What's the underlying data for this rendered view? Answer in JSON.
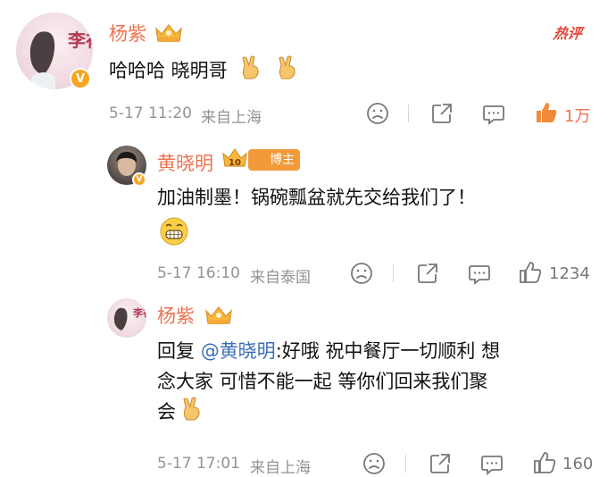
{
  "comments": [
    {
      "username": "杨紫",
      "text": "哈哈哈 晓明哥",
      "time": "5-17 11:20",
      "location": "来自上海",
      "likes": "1万",
      "hot_label": "热评",
      "avatar_text": "李祐"
    },
    {
      "username": "黄晓明",
      "level": "10",
      "blogger_label": "博主",
      "text": "加油制墨！锅碗瓢盆就先交给我们了！",
      "time": "5-17 16:10",
      "location": "来自泰国",
      "likes": "1234"
    },
    {
      "username": "杨紫",
      "reply_prefix": "回复 ",
      "mention": "@黄晓明",
      "text_line1": ":好哦 祝中餐厅一切顺利 想",
      "text_line2": "念大家 可惜不能一起 等你们回来我们聚",
      "text_line3": "会",
      "time": "5-17 17:01",
      "location": "来自上海",
      "likes": "160"
    }
  ],
  "icons": {
    "dislike": "sad-face-icon",
    "share": "share-icon",
    "reply": "comment-icon",
    "like": "thumbs-up-icon",
    "vip": "vip-crown-icon",
    "verify": "verified-icon",
    "victory": "victory-hand-icon",
    "grin": "grin-emoji-icon"
  },
  "colors": {
    "username": "#eb7350",
    "meta": "#939393",
    "mention": "#3a6fb5",
    "hot": "#e8453c",
    "like_active": "#eb7350"
  }
}
